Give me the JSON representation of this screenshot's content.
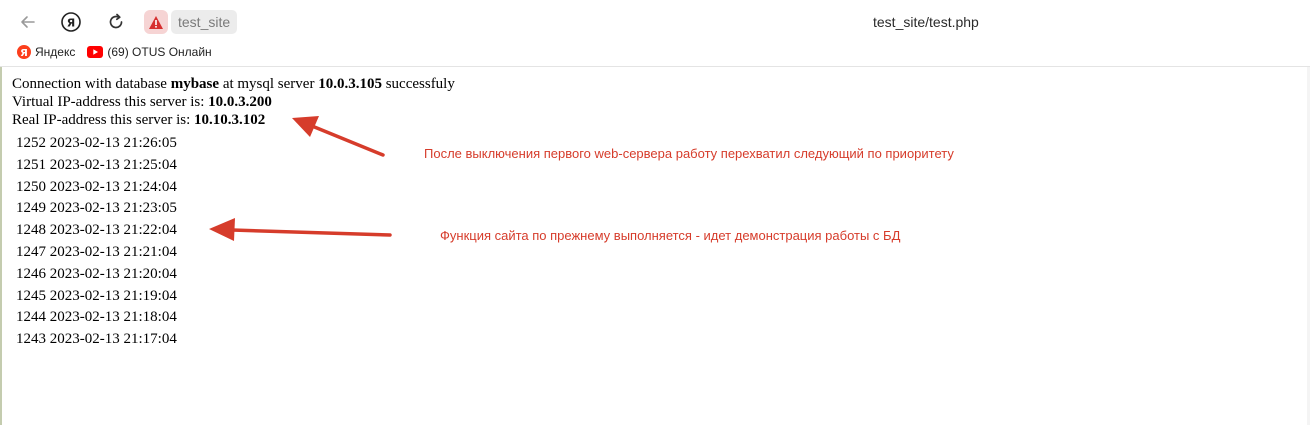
{
  "browser": {
    "site_chip": "test_site",
    "page_url": "test_site/test.php",
    "bookmarks": [
      {
        "label": "Яндекс",
        "icon": "yandex-icon"
      },
      {
        "label": "(69) OTUS Онлайн",
        "icon": "youtube-icon"
      }
    ]
  },
  "content": {
    "line1": {
      "prefix": "Connection with database ",
      "db": "mybase",
      "mid": " at mysql server ",
      "server": "10.0.3.105",
      "suffix": " successfuly"
    },
    "line2": {
      "prefix": "Virtual IP-address this server is: ",
      "ip": "10.0.3.200"
    },
    "line3": {
      "prefix": "Real IP-address this server is: ",
      "ip": "10.10.3.102"
    },
    "rows": [
      "1252 2023-02-13 21:26:05",
      "1251 2023-02-13 21:25:04",
      "1250 2023-02-13 21:24:04",
      "1249 2023-02-13 21:23:05",
      "1248 2023-02-13 21:22:04",
      "1247 2023-02-13 21:21:04",
      "1246 2023-02-13 21:20:04",
      "1245 2023-02-13 21:19:04",
      "1244 2023-02-13 21:18:04",
      "1243 2023-02-13 21:17:04"
    ]
  },
  "annotations": {
    "note1": "После выключения первого web-сервера работу перехватил следующий по приоритету",
    "note2": "Функция сайта по прежнему выполняется - идет демонстрация работы с БД"
  },
  "colors": {
    "annotation_red": "#d63c2b",
    "warning_bg": "#f6d4d4"
  }
}
